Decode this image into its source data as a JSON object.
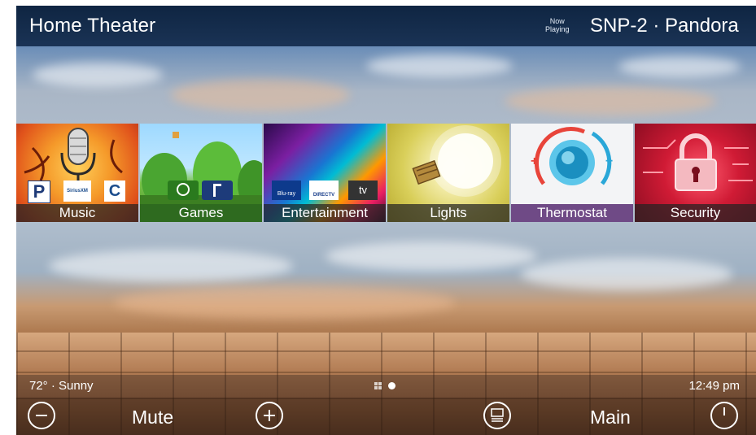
{
  "header": {
    "title": "Home Theater",
    "now_playing_line1": "Now",
    "now_playing_line2": "Playing",
    "now_playing_value": "SNP-2 · Pandora"
  },
  "tiles": [
    {
      "label": "Music",
      "icons": [
        "pandora-icon",
        "siriusxm-icon",
        "crestron-icon"
      ]
    },
    {
      "label": "Games",
      "icons": [
        "xbox-icon",
        "playstation-icon"
      ]
    },
    {
      "label": "Entertainment",
      "icons": [
        "bluray-icon",
        "directv-icon",
        "appletv-icon"
      ]
    },
    {
      "label": "Lights",
      "icons": [
        "lightbulb-icon"
      ]
    },
    {
      "label": "Thermostat",
      "icons": [
        "thermostat-dial-icon"
      ]
    },
    {
      "label": "Security",
      "icons": [
        "padlock-icon"
      ]
    }
  ],
  "music_icon_text": {
    "p": "P",
    "sirius": "SiriusXM",
    "c": "C"
  },
  "ent_icon_text": {
    "bluray": "Blu-ray",
    "directv": "DIRECTV",
    "atv": "tv"
  },
  "thermo_text": {
    "plus": "+",
    "minus": "−"
  },
  "status": {
    "weather": "72° · Sunny",
    "time": "12:49 pm"
  },
  "controls": {
    "mute": "Mute",
    "main": "Main"
  },
  "colors": {
    "header_bg": "#1a3355",
    "tile_label_bg": "#232323",
    "games_label_bg": "#2e6a1f",
    "thermostat_label_bg": "#6f4a86",
    "thermostat_accent": "#e8443a"
  }
}
